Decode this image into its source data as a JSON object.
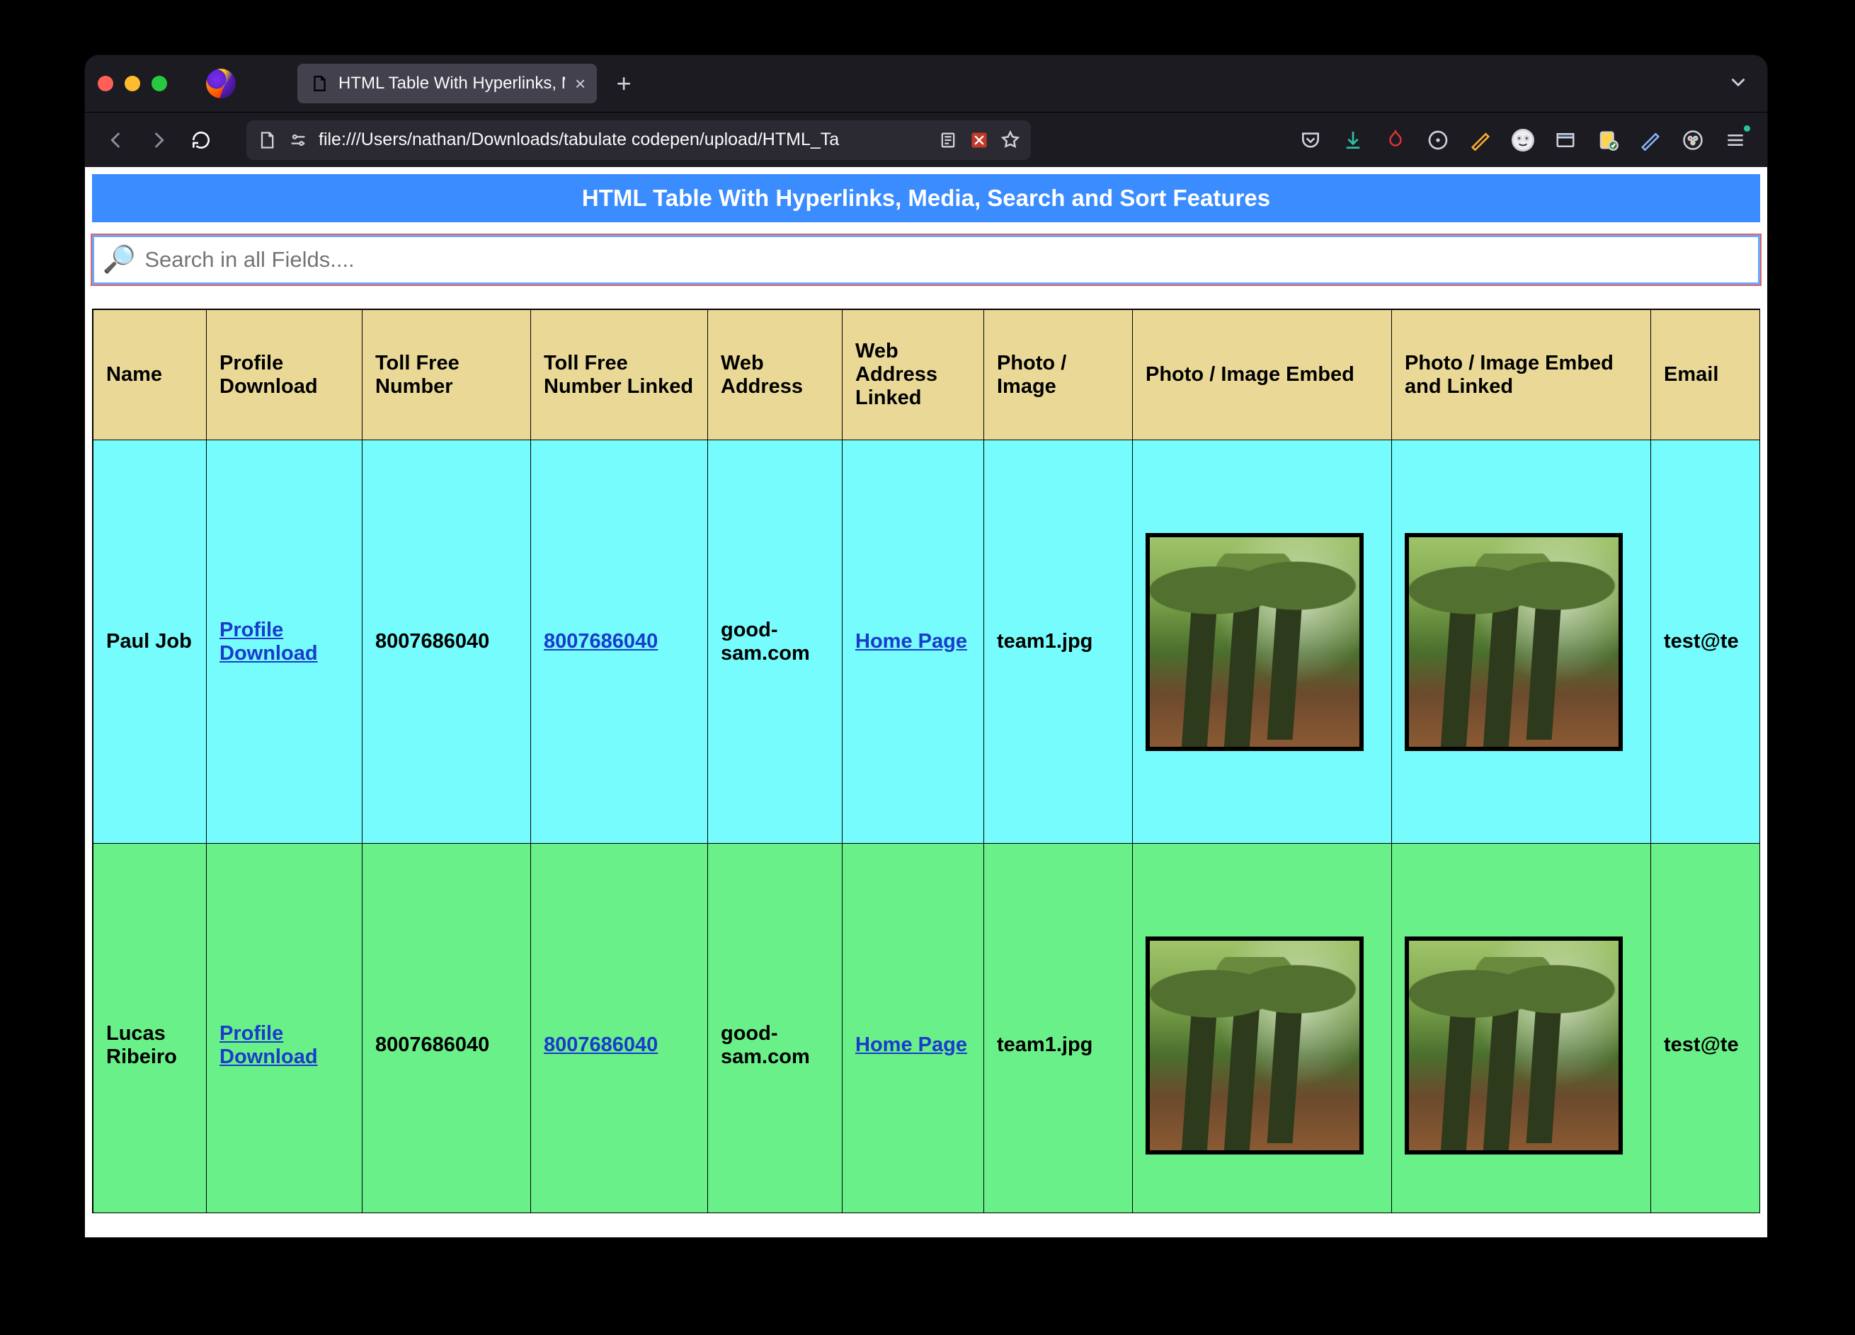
{
  "browser": {
    "tab_title": "HTML Table With Hyperlinks, Media,",
    "url": "file:///Users/nathan/Downloads/tabulate codepen/upload/HTML_Ta"
  },
  "page": {
    "title": "HTML Table With Hyperlinks, Media, Search and Sort Features",
    "search_placeholder": "Search in all Fields...."
  },
  "columns": [
    "Name",
    "Profile Download",
    "Toll Free Number",
    "Toll Free Number Linked",
    "Web Address",
    "Web Address Linked",
    "Photo / Image",
    "Photo / Image Embed",
    "Photo / Image Embed and Linked",
    "Email"
  ],
  "rows": [
    {
      "name": "Paul Job",
      "profile_download": "Profile Download",
      "toll_free": "8007686040",
      "toll_free_link": "8007686040",
      "web": "good-sam.com",
      "web_link": "Home Page",
      "photo": "team1.jpg",
      "email": "test@te"
    },
    {
      "name": "Lucas Ribeiro",
      "profile_download": "Profile Download",
      "toll_free": "8007686040",
      "toll_free_link": "8007686040",
      "web": "good-sam.com",
      "web_link": "Home Page",
      "photo": "team1.jpg",
      "email": "test@te"
    }
  ]
}
